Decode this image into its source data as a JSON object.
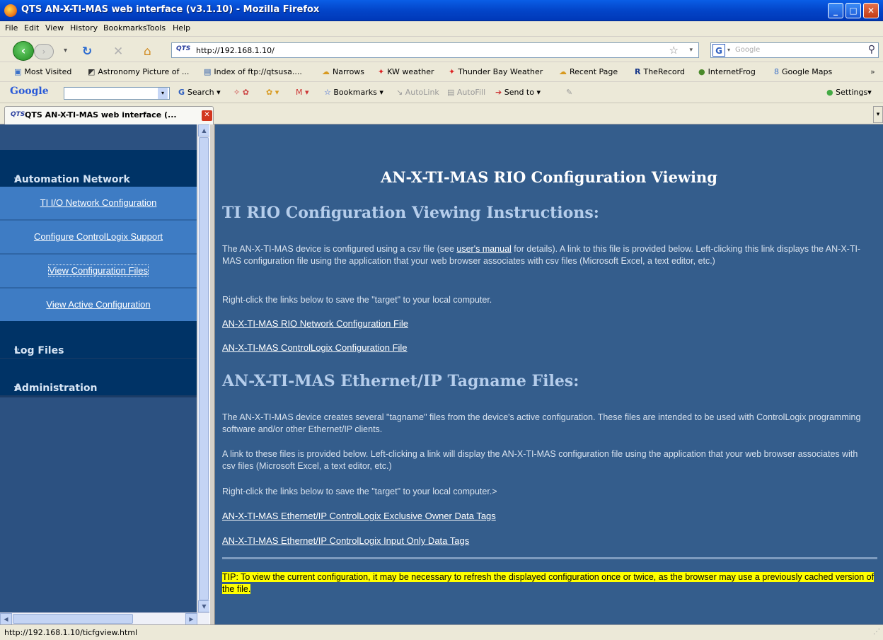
{
  "window": {
    "title": "QTS AN-X-TI-MAS web interface (v3.1.10) - Mozilla Firefox",
    "min": "_",
    "max": "□",
    "close": "✕"
  },
  "menu": [
    "File",
    "Edit",
    "View",
    "History",
    "Bookmarks",
    "Tools",
    "Help"
  ],
  "nav": {
    "url": "http://192.168.1.10/",
    "site_icon": "QTS",
    "search_engine": "G",
    "search_placeholder": "Google"
  },
  "bookmarks": [
    "Most Visited",
    "Astronomy Picture of ...",
    "Index of ftp://qtsusa....",
    "Narrows",
    "KW weather",
    "Thunder Bay Weather",
    "Recent Page",
    "TheRecord",
    "InternetFrog",
    "Google Maps"
  ],
  "google_toolbar": {
    "logo": "Google",
    "search": "Search",
    "bookmarks": "Bookmarks",
    "autolink": "AutoLink",
    "autofill": "AutoFill",
    "sendto": "Send to",
    "settings": "Settings"
  },
  "tab": {
    "icon": "QTS",
    "title": "QTS AN-X-TI-MAS web interface (..."
  },
  "sidebar": {
    "sections": [
      {
        "label": "Automation Network",
        "items": [
          "TI I/O Network Configuration",
          "Configure ControlLogix Support",
          "View Configuration Files",
          "View Active Configuration"
        ]
      },
      {
        "label": "Log Files"
      },
      {
        "label": "Administration"
      }
    ]
  },
  "main": {
    "title": "AN-X-TI-MAS RIO Configuration Viewing",
    "section1": {
      "heading": "TI RIO Configuration Viewing Instructions:",
      "p1_pre": "The AN-X-TI-MAS device is configured using a csv file (see ",
      "p1_link": "user's manual",
      "p1_post": " for details). A link to this file is provided below. Left-clicking this link displays the AN-X-TI-MAS configuration file using the application that your web browser associates with csv files (Microsoft Excel, a text editor, etc.)",
      "p2": "Right-click the links below to save the \"target\" to your local computer.",
      "links": [
        "AN-X-TI-MAS RIO Network Configuration File",
        "AN-X-TI-MAS ControlLogix Configuration File"
      ]
    },
    "section2": {
      "heading": "AN-X-TI-MAS Ethernet/IP Tagname Files:",
      "p1": "The AN-X-TI-MAS device creates several \"tagname\" files from the device's active configuration. These files are intended to be used with ControlLogix programming software and/or other Ethernet/IP clients.",
      "p2": "A link to these files is provided below. Left-clicking a link will display the AN-X-TI-MAS configuration file using the application that your web browser associates with csv files (Microsoft Excel, a text editor, etc.)",
      "p3": "Right-click the links below to save the \"target\" to your local computer.>",
      "links": [
        "AN-X-TI-MAS Ethernet/IP ControlLogix Exclusive Owner Data Tags",
        "AN-X-TI-MAS Ethernet/IP ControlLogix Input Only Data Tags"
      ]
    },
    "tip": "TIP: To view the current configuration, it may be necessary to refresh the displayed configuration once or twice, as the browser may use a previously cached version of the file."
  },
  "status": {
    "text": "http://192.168.1.10/ticfgview.html"
  }
}
